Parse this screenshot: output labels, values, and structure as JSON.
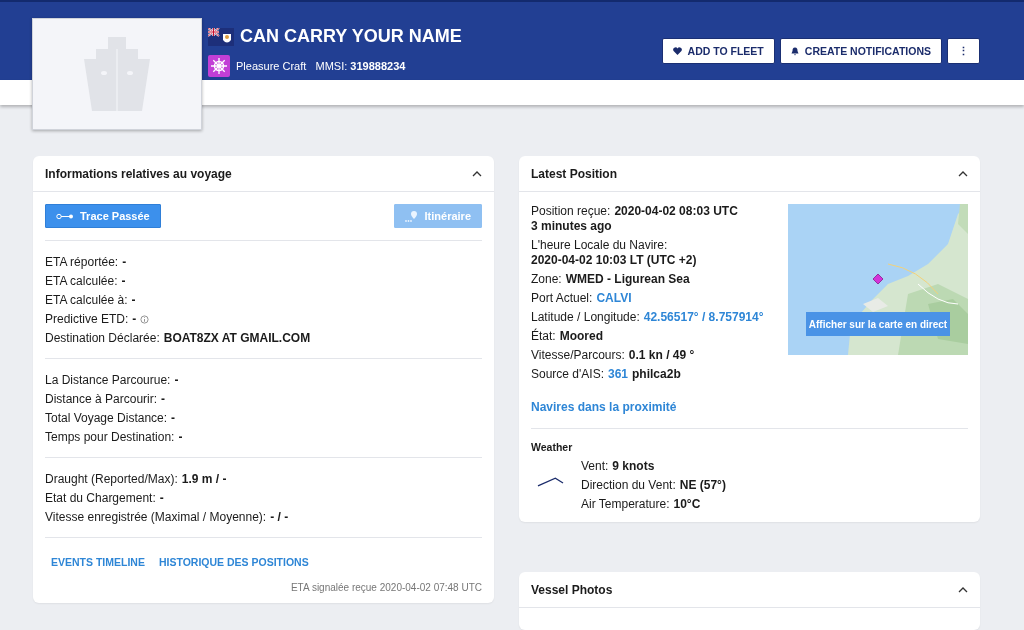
{
  "vessel": {
    "name": "CAN CARRY YOUR NAME",
    "type": "Pleasure Craft",
    "mmsi_label": "MMSI:",
    "mmsi": "319888234"
  },
  "actions": [
    {
      "label": "ADD TO FLEET",
      "kind": "heart"
    },
    {
      "label": "CREATE NOTIFICATIONS",
      "kind": "bell"
    },
    {
      "label": "⋮",
      "kind": "more"
    }
  ],
  "voyage": {
    "title": "Informations relatives au voyage",
    "expanded": true,
    "buttons": [
      {
        "label": "Trace Passée",
        "disabled": false,
        "kind": "track"
      },
      {
        "label": "Itinéraire",
        "disabled": true,
        "kind": "pin"
      }
    ],
    "sections": [
      [
        {
          "label": "ETA réportée:",
          "values": [
            {
              "text": "-",
              "kind": "bold"
            }
          ]
        },
        {
          "label": "ETA calculée:",
          "values": [
            {
              "text": "-",
              "kind": "bold"
            }
          ]
        },
        {
          "label": "ETA calculée à:",
          "values": [
            {
              "text": "-",
              "kind": "bold"
            }
          ]
        },
        {
          "label": "Predictive ETD:",
          "values": [
            {
              "text": "-",
              "kind": "bold"
            }
          ],
          "info": true
        },
        {
          "label": "Destination Déclarée:",
          "values": [
            {
              "text": "BOAT8ZX AT GMAIL.COM",
              "kind": "bold"
            }
          ]
        }
      ],
      [
        {
          "label": "La Distance Parcourue:",
          "values": [
            {
              "text": "-",
              "kind": "bold"
            }
          ]
        },
        {
          "label": "Distance à Parcourir:",
          "values": [
            {
              "text": "-",
              "kind": "bold"
            }
          ]
        },
        {
          "label": "Total Voyage Distance:",
          "values": [
            {
              "text": "-",
              "kind": "bold"
            }
          ]
        },
        {
          "label": "Temps pour Destination:",
          "values": [
            {
              "text": "-",
              "kind": "bold"
            }
          ]
        }
      ],
      [
        {
          "label": "Draught (Reported/Max):",
          "values": [
            {
              "text": "1.9 m / -",
              "kind": "bold"
            }
          ]
        },
        {
          "label": "Etat du Chargement:",
          "values": [
            {
              "text": "-",
              "kind": "bold"
            }
          ]
        },
        {
          "label": "Vitesse enregistrée (Maximal / Moyenne):",
          "values": [
            {
              "text": "- / -",
              "kind": "bold"
            }
          ]
        }
      ]
    ],
    "links": [
      "EVENTS TIMELINE",
      "HISTORIQUE DES POSITIONS"
    ],
    "note": "ETA signalée reçue 2020-04-02 07:48 UTC"
  },
  "position": {
    "title": "Latest Position",
    "expanded": true,
    "rows": [
      {
        "label": "Position reçue:",
        "values": [
          {
            "text": "2020-04-02 08:03 UTC",
            "kind": "bold"
          }
        ]
      },
      {
        "label": "",
        "values": [
          {
            "text": "3 minutes ago",
            "kind": "bold"
          }
        ],
        "gap": false
      },
      {
        "label": "L'heure Locale du Navire:",
        "values": []
      },
      {
        "label": "",
        "values": [
          {
            "text": "2020-04-02 10:03 LT (UTC +2)",
            "kind": "bold"
          }
        ],
        "gap": false
      },
      {
        "label": "Zone:",
        "values": [
          {
            "text": "WMED - Ligurean Sea",
            "kind": "bold"
          }
        ]
      },
      {
        "label": "Port Actuel:",
        "values": [
          {
            "text": "CALVI",
            "kind": "link"
          }
        ]
      },
      {
        "label": "Latitude / Longitude:",
        "values": [
          {
            "text": "42.56517° / 8.757914°",
            "kind": "link"
          }
        ]
      },
      {
        "label": "État:",
        "values": [
          {
            "text": "Moored",
            "kind": "bold"
          }
        ]
      },
      {
        "label": "Vitesse/Parcours:",
        "values": [
          {
            "text": "0.1 kn / 49 °",
            "kind": "bold"
          }
        ]
      },
      {
        "label": "Source d'AIS:",
        "values": [
          {
            "text": "361",
            "kind": "link"
          },
          {
            "text": "philca2b",
            "kind": "bold"
          }
        ]
      }
    ],
    "map": {
      "kind": "picture",
      "button": "Afficher sur la carte en direct"
    },
    "nearby": "Navires dans la proximité",
    "weather": {
      "title": "Weather",
      "rows": [
        {
          "label": "Vent:",
          "values": [
            {
              "text": "9 knots",
              "kind": "bold"
            }
          ]
        },
        {
          "label": "Direction du Vent:",
          "values": [
            {
              "text": "NE (57°)",
              "kind": "bold"
            }
          ]
        },
        {
          "label": "Air Temperature:",
          "values": [
            {
              "text": "10°C",
              "kind": "bold"
            }
          ]
        }
      ]
    }
  },
  "photos": {
    "title": "Vessel Photos",
    "expanded": true
  }
}
